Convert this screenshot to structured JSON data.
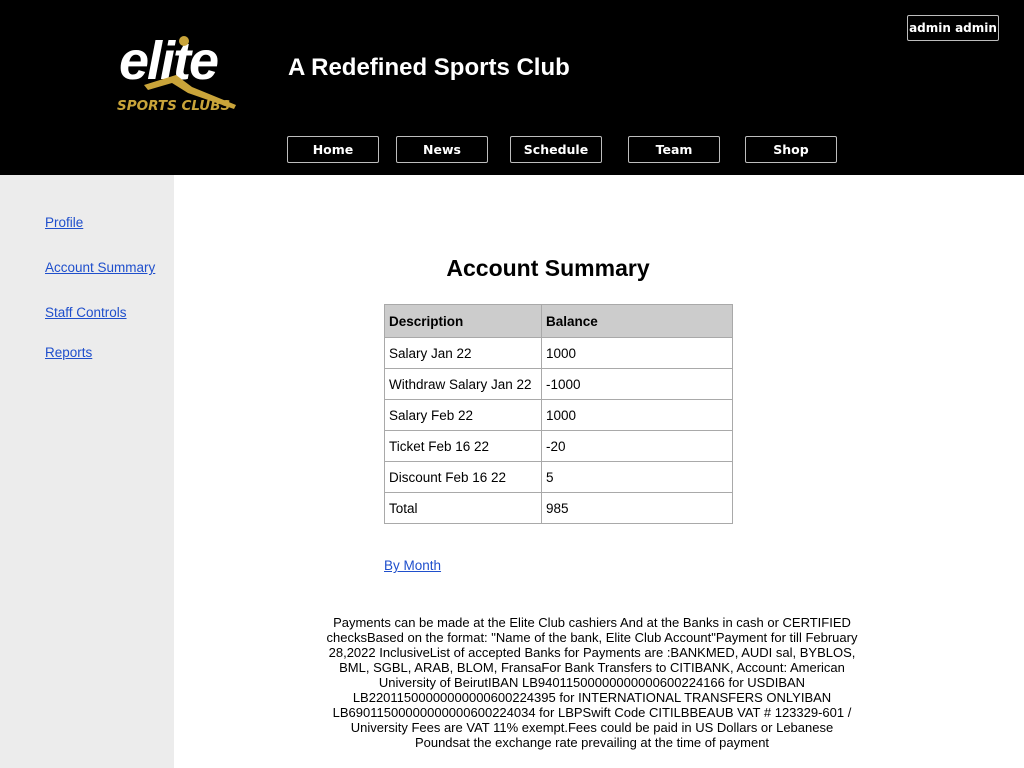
{
  "header": {
    "logo_text": "elite",
    "logo_subtext": "SPORTS CLUBS",
    "title": "A Redefined Sports Club",
    "user_button": "admin admin",
    "colors": {
      "background": "#000000",
      "logo_gold": "#c9a43a"
    }
  },
  "nav": {
    "items": [
      {
        "label": "Home"
      },
      {
        "label": "News"
      },
      {
        "label": "Schedule"
      },
      {
        "label": "Team"
      },
      {
        "label": "Shop"
      }
    ]
  },
  "sidebar": {
    "items": [
      {
        "label": "Profile"
      },
      {
        "label": "Account Summary"
      },
      {
        "label": "Staff Controls"
      },
      {
        "label": "Reports"
      }
    ]
  },
  "main": {
    "title": "Account Summary",
    "table": {
      "headers": [
        "Description",
        "Balance"
      ],
      "rows": [
        [
          "Salary Jan 22",
          "1000"
        ],
        [
          "Withdraw Salary Jan 22",
          "-1000"
        ],
        [
          "Salary Feb 22",
          "1000"
        ],
        [
          "Ticket Feb 16 22",
          "-20"
        ],
        [
          "Discount Feb 16 22",
          "5"
        ],
        [
          "Total",
          "985"
        ]
      ]
    },
    "by_month_link": "By Month",
    "payments_text": "Payments can be made at the Elite Club cashiers And at the Banks in cash or CERTIFIED checksBased on the format: \"Name of the bank, Elite Club Account\"Payment for till February 28,2022 InclusiveList of accepted Banks for Payments are :BANKMED, AUDI sal, BYBLOS, BML, SGBL, ARAB, BLOM, FransaFor Bank Transfers to CITIBANK, Account: American University of BeirutIBAN LB94011500000000000600224166 for USDIBAN LB22011500000000000600224395 for INTERNATIONAL TRANSFERS ONLYIBAN LB69011500000000000600224034 for LBPSwift Code CITILBBEAUB VAT # 123329-601 / University Fees are VAT 11% exempt.Fees could be paid in US Dollars or Lebanese Poundsat the exchange rate prevailing at the time of payment"
  }
}
